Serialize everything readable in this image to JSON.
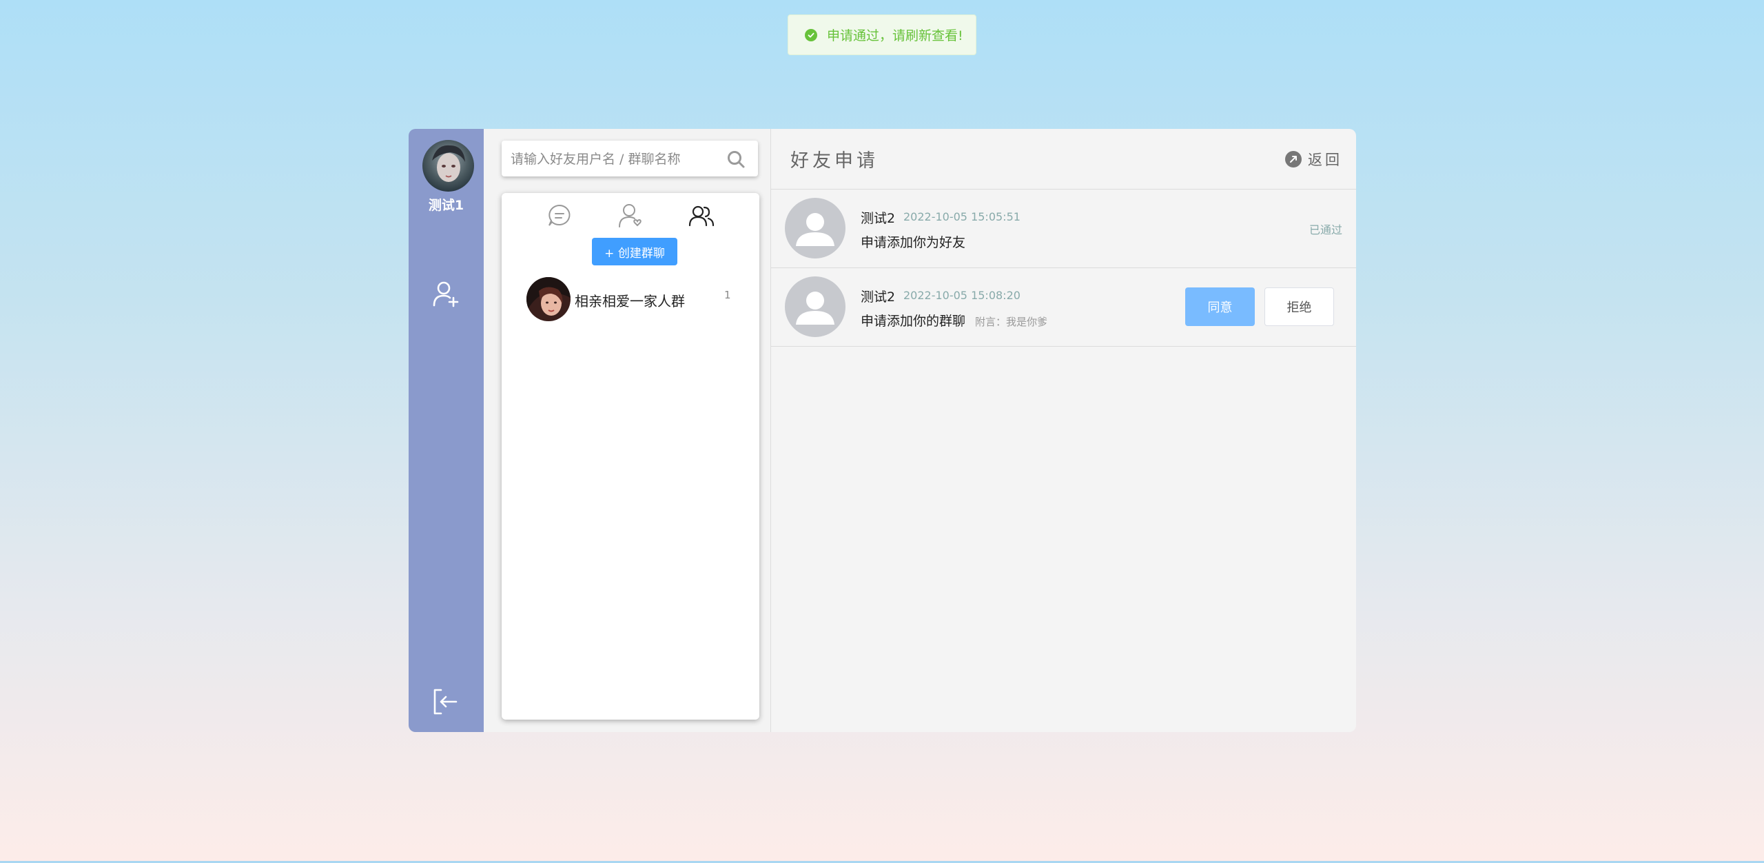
{
  "toast": {
    "message": "申请通过，请刷新查看!",
    "color": "#67c23a"
  },
  "sidebar": {
    "user_name": "测试1",
    "bg_color": "#8a9acc",
    "icons": [
      "add-user-icon",
      "logout-icon"
    ]
  },
  "search": {
    "placeholder": "请输入好友用户名 / 群聊名称"
  },
  "tabs": [
    "chat-bubble-icon",
    "contacts-icon",
    "groups-icon"
  ],
  "create_group_label": "+ 创建群聊",
  "groups": [
    {
      "name": "相亲相爱一家人群",
      "count": "1"
    }
  ],
  "detail": {
    "title": "好友申请",
    "back_label": "返回",
    "requests": [
      {
        "name": "测试2",
        "time": "2022-10-05 15:05:51",
        "message": "申请添加你为好友",
        "note": "",
        "status": "已通过"
      },
      {
        "name": "测试2",
        "time": "2022-10-05 15:08:20",
        "message": "申请添加你的群聊",
        "note": "附言：我是你爹",
        "agree_label": "同意",
        "reject_label": "拒绝"
      }
    ]
  },
  "colors": {
    "primary": "#409eff",
    "agree": "#79bbff"
  }
}
